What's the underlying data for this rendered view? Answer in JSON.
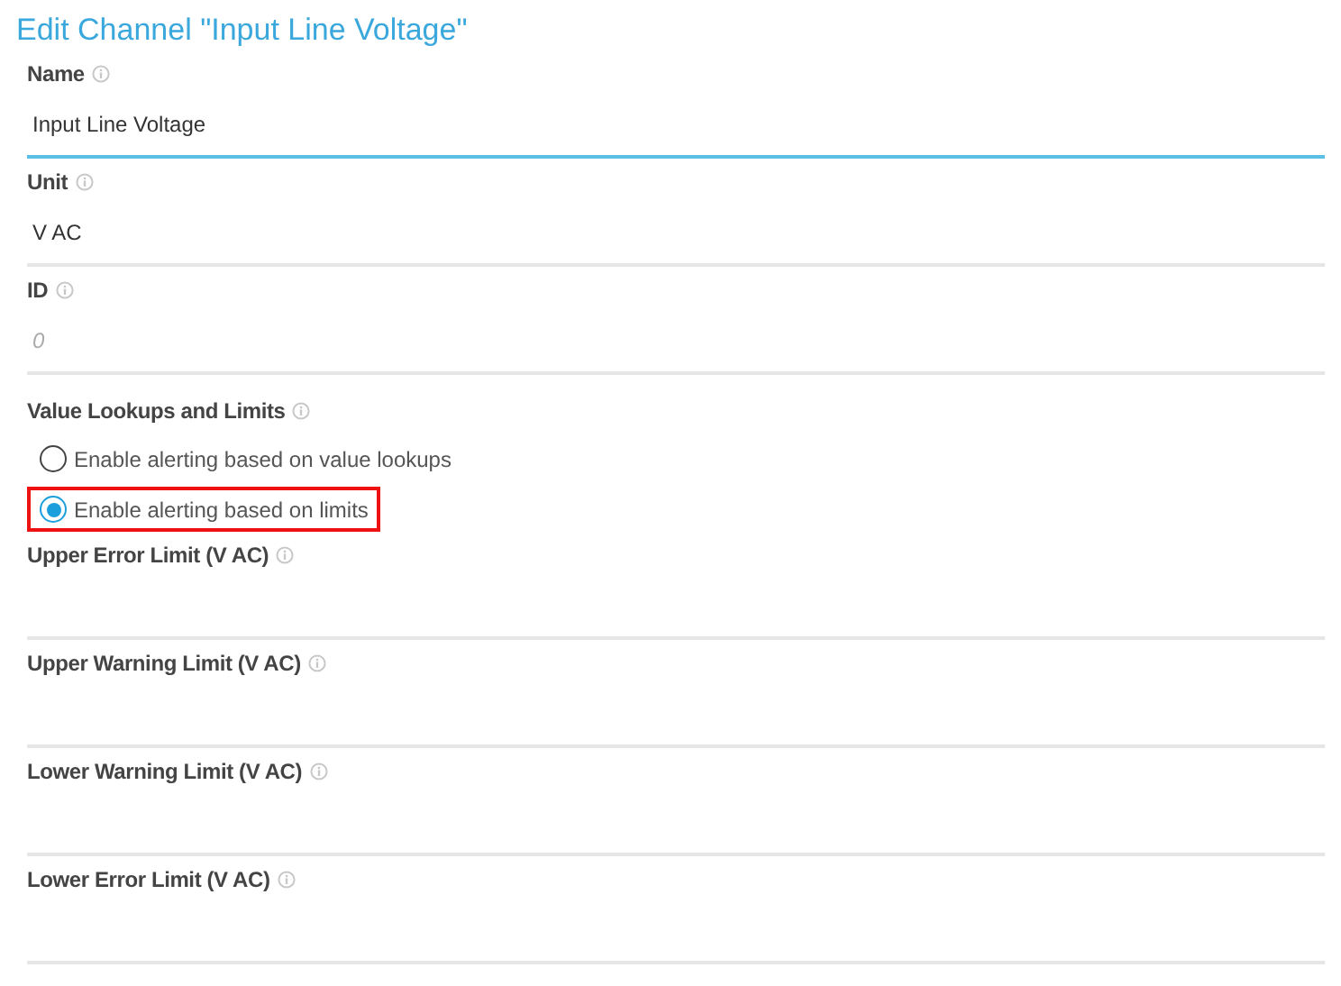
{
  "title": "Edit Channel \"Input Line Voltage\"",
  "fields": [
    {
      "kind": "text",
      "label": "Name",
      "value": "Input Line Voltage",
      "focused": true
    },
    {
      "kind": "text",
      "label": "Unit",
      "value": "V AC",
      "focused": false
    },
    {
      "kind": "text",
      "label": "ID",
      "placeholder": "0",
      "focused": false
    },
    {
      "kind": "radio",
      "label": "Value Lookups and Limits",
      "options": [
        {
          "label": "Enable alerting based on value lookups",
          "selected": false,
          "highlighted": false
        },
        {
          "label": "Enable alerting based on limits",
          "selected": true,
          "highlighted": true
        }
      ]
    },
    {
      "kind": "text",
      "label": "Upper Error Limit (V AC)",
      "focused": false
    },
    {
      "kind": "text",
      "label": "Upper Warning Limit (V AC)",
      "focused": false
    },
    {
      "kind": "text",
      "label": "Lower Warning Limit (V AC)",
      "focused": false
    },
    {
      "kind": "text",
      "label": "Lower Error Limit (V AC)",
      "focused": false
    }
  ]
}
